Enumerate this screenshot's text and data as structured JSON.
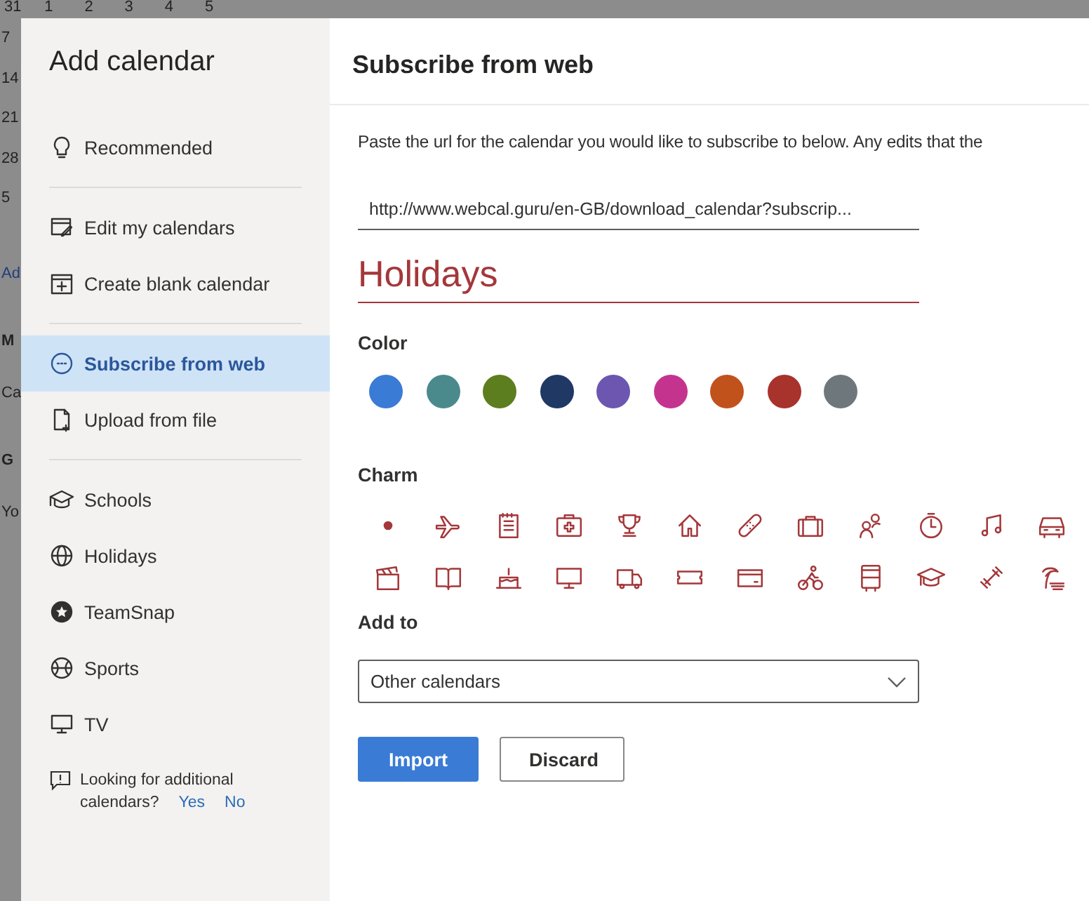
{
  "background": {
    "top_row": [
      "31",
      "1",
      "2",
      "3",
      "4",
      "5"
    ],
    "left_column": [
      {
        "text": "7",
        "kind": "day"
      },
      {
        "text": "14",
        "kind": "day"
      },
      {
        "text": "21",
        "kind": "day"
      },
      {
        "text": "28",
        "kind": "day"
      },
      {
        "text": "5",
        "kind": "day"
      },
      {
        "text": "Ad",
        "kind": "link"
      },
      {
        "text": "M",
        "kind": "heading"
      },
      {
        "text": "Ca",
        "kind": "item"
      },
      {
        "text": "G",
        "kind": "heading"
      },
      {
        "text": "Yo",
        "kind": "item"
      }
    ]
  },
  "sidebar": {
    "title": "Add calendar",
    "groups": [
      [
        {
          "label": "Recommended",
          "selected": false
        }
      ],
      [
        {
          "label": "Edit my calendars",
          "selected": false
        },
        {
          "label": "Create blank calendar",
          "selected": false
        }
      ],
      [
        {
          "label": "Subscribe from web",
          "selected": true
        },
        {
          "label": "Upload from file",
          "selected": false
        }
      ],
      [
        {
          "label": "Schools",
          "selected": false
        },
        {
          "label": "Holidays",
          "selected": false
        },
        {
          "label": "TeamSnap",
          "selected": false
        },
        {
          "label": "Sports",
          "selected": false
        },
        {
          "label": "TV",
          "selected": false
        }
      ]
    ],
    "feedback": {
      "lines": [
        "Looking for additional",
        "calendars?"
      ],
      "links": [
        "Yes",
        "No"
      ]
    }
  },
  "main": {
    "title": "Subscribe from web",
    "description": "Paste the url for the calendar you would like to subscribe to below. Any edits that the",
    "url": {
      "value": "http://www.webcal.guru/en-GB/download_calendar?subscrip..."
    },
    "name": {
      "value": "Holidays"
    },
    "color_label": "Color",
    "colors": [
      {
        "color": "#3a7bd5"
      },
      {
        "color": "#4a8a8c"
      },
      {
        "color": "#5c7e1e"
      },
      {
        "color": "#1f3864"
      },
      {
        "color": "#6c56b0"
      },
      {
        "color": "#c4348f"
      },
      {
        "color": "#c2521c"
      },
      {
        "color": "#a8322c"
      },
      {
        "color": "#6e777c"
      }
    ],
    "charm_label": "Charm",
    "add_to_label": "Add to",
    "add_to": {
      "value": "Other calendars"
    },
    "buttons": [
      {
        "label": "Import",
        "kind": "primary"
      },
      {
        "label": "Discard",
        "kind": "secondary"
      }
    ]
  }
}
